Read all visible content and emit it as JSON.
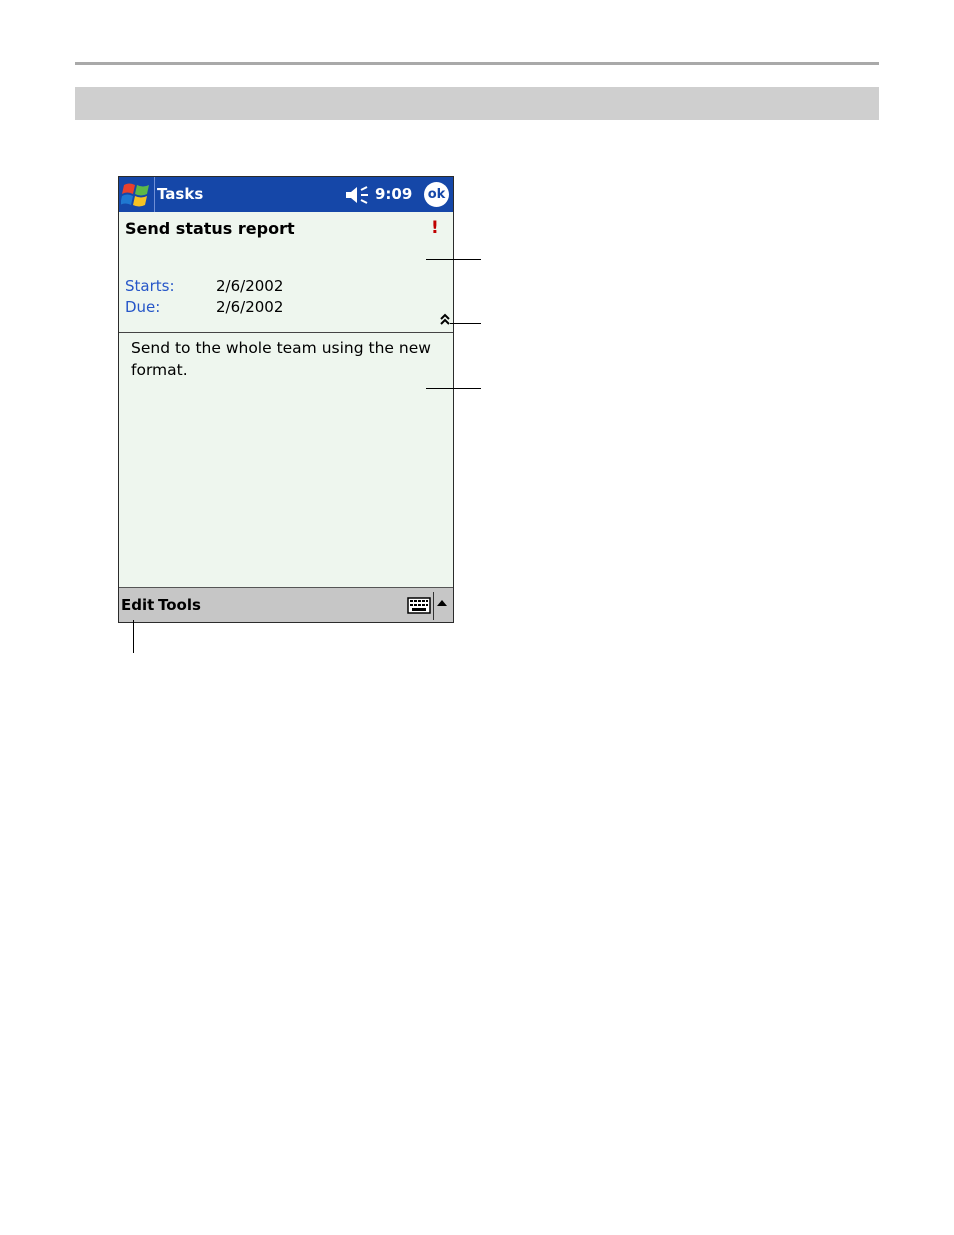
{
  "window": {
    "app_title": "Tasks",
    "clock": "9:09",
    "ok_label": "ok"
  },
  "task": {
    "subject": "Send status report",
    "priority_marker": "!",
    "fields": [
      {
        "label": "Starts:",
        "value": "2/6/2002"
      },
      {
        "label": "Due:",
        "value": "2/6/2002"
      }
    ],
    "notes": "Send to the whole team using the new format."
  },
  "menubar": {
    "items": [
      "Edit",
      "Tools"
    ]
  },
  "icons": {
    "start": "windows-flag-icon",
    "speaker": "speaker-muted-icon",
    "priority": "exclamation-icon",
    "collapse": "double-chevron-up-icon",
    "keyboard": "keyboard-icon",
    "sip": "triangle-up-icon"
  },
  "colors": {
    "titlebar": "#1547a8",
    "background": "#eef6ee",
    "menubar": "#c6c6c6",
    "field_label": "#2656c8",
    "priority": "#c00000"
  }
}
